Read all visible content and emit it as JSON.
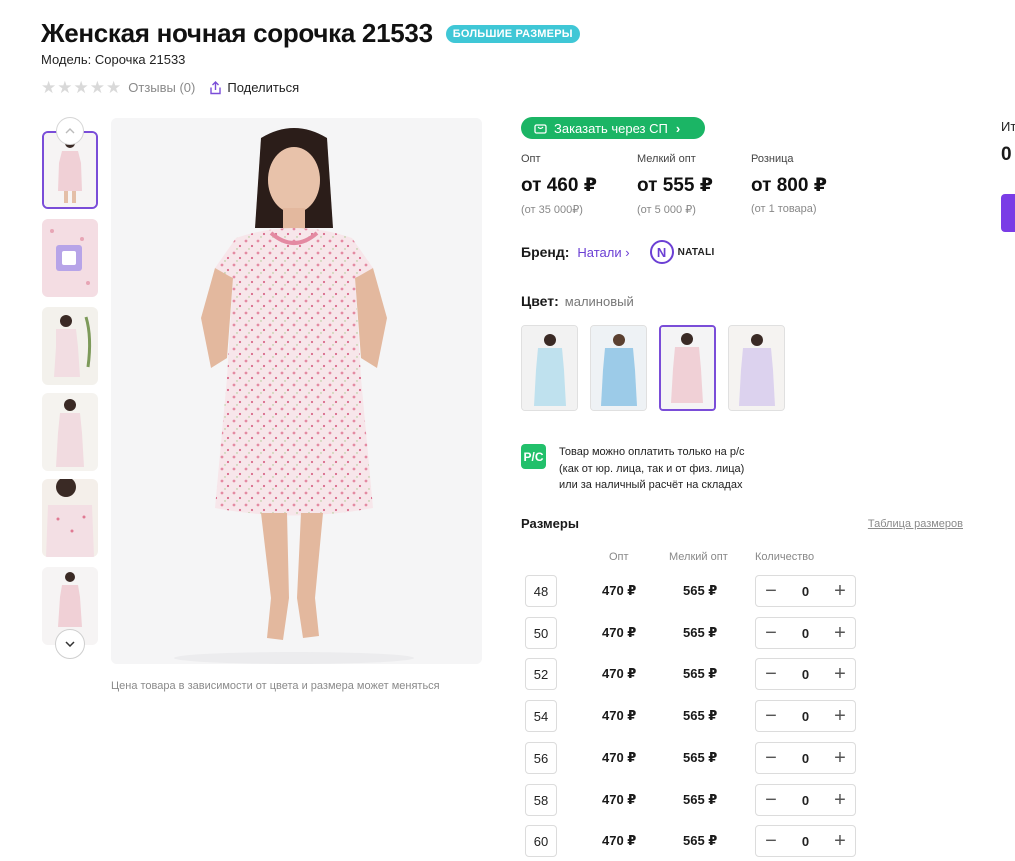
{
  "product": {
    "title": "Женская ночная сорочка 21533",
    "badge": "БОЛЬШИЕ РАЗМЕРЫ",
    "model": "Модель: Сорочка 21533",
    "rating_stars": 0,
    "reviews": "Отзывы (0)",
    "share": "Поделиться"
  },
  "gallery": {
    "price_note": "Цена товара в зависимости от цвета и размера может меняться"
  },
  "order": {
    "label": "Заказать через СП"
  },
  "prices": [
    {
      "label": "Опт",
      "value": "от 460 ₽",
      "sub": "(от 35 000₽)"
    },
    {
      "label": "Мелкий опт",
      "value": "от 555 ₽",
      "sub": "(от 5 000 ₽)"
    },
    {
      "label": "Розница",
      "value": "от 800 ₽",
      "sub": "(от 1 товара)"
    }
  ],
  "brand": {
    "label": "Бренд:",
    "name": "Натали",
    "logo_text": "NATALI"
  },
  "color": {
    "label": "Цвет:",
    "value": "малиновый"
  },
  "payment": {
    "icon_text": "Р/С",
    "line1": "Товар можно оплатить только на р/с",
    "line2": "(как от юр. лица, так и от физ. лица)",
    "line3": "или за наличный расчёт на складах"
  },
  "sizes": {
    "title": "Размеры",
    "table_link": "Таблица размеров",
    "col_opt": "Опт",
    "col_small": "Мелкий опт",
    "col_qty": "Количество",
    "rows": [
      {
        "size": "48",
        "opt": "470 ₽",
        "small": "565 ₽",
        "qty": "0"
      },
      {
        "size": "50",
        "opt": "470 ₽",
        "small": "565 ₽",
        "qty": "0"
      },
      {
        "size": "52",
        "opt": "470 ₽",
        "small": "565 ₽",
        "qty": "0"
      },
      {
        "size": "54",
        "opt": "470 ₽",
        "small": "565 ₽",
        "qty": "0"
      },
      {
        "size": "56",
        "opt": "470 ₽",
        "small": "565 ₽",
        "qty": "0"
      },
      {
        "size": "58",
        "opt": "470 ₽",
        "small": "565 ₽",
        "qty": "0"
      },
      {
        "size": "60",
        "opt": "470 ₽",
        "small": "565 ₽",
        "qty": "0"
      }
    ]
  },
  "sidebar_partial": {
    "label": "Ит",
    "value": "0"
  },
  "colors": {
    "accent": "#7a4dd8",
    "green": "#1bb565",
    "badge": "#3fc7d6"
  }
}
